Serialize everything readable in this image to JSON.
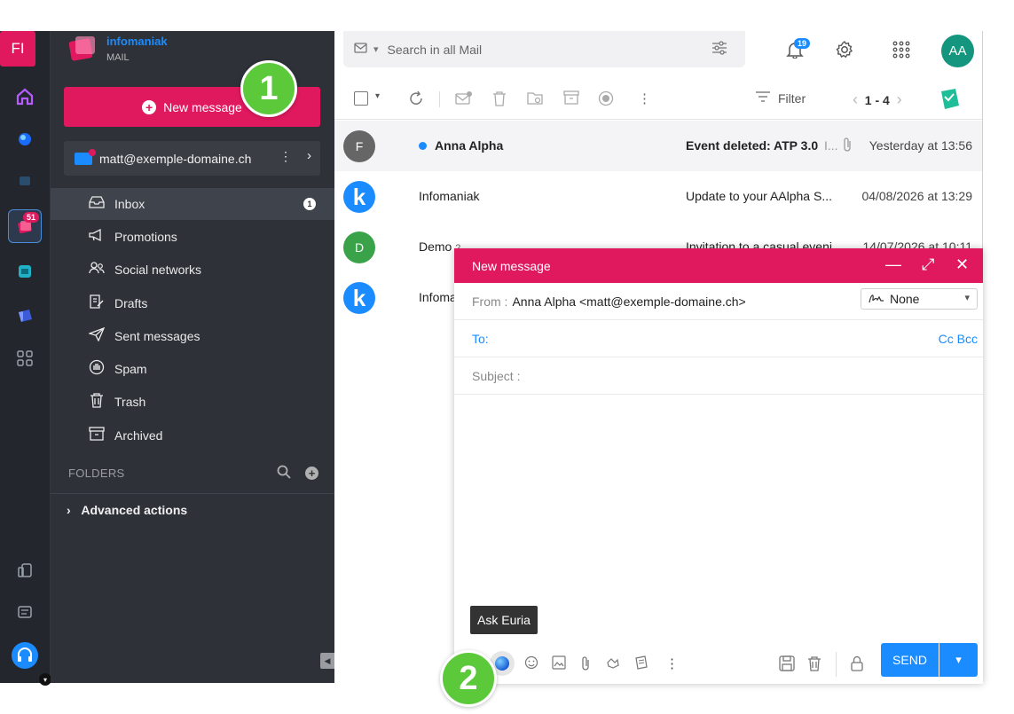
{
  "rail": {
    "avatar_initials": "FI",
    "badge_count": "51"
  },
  "sidebar": {
    "brand_name": "infomaniak",
    "brand_sub": "MAIL",
    "new_message_label": "New message",
    "account_email": "matt@exemple-domaine.ch",
    "items": [
      {
        "label": "Inbox",
        "icon": "inbox-icon",
        "count": "1"
      },
      {
        "label": "Promotions",
        "icon": "megaphone-icon"
      },
      {
        "label": "Social networks",
        "icon": "people-icon"
      },
      {
        "label": "Drafts",
        "icon": "draft-icon"
      },
      {
        "label": "Sent messages",
        "icon": "send-icon"
      },
      {
        "label": "Spam",
        "icon": "spam-icon"
      },
      {
        "label": "Trash",
        "icon": "trash-icon"
      },
      {
        "label": "Archived",
        "icon": "archive-icon"
      }
    ],
    "folders_header": "FOLDERS",
    "advanced_actions": "Advanced actions"
  },
  "header": {
    "search_placeholder": "Search in all Mail",
    "notifications_count": "19",
    "user_initials": "AA"
  },
  "toolbar": {
    "filter_label": "Filter",
    "pager": "1 - 4"
  },
  "messages": [
    {
      "initial": "F",
      "avatar_color": "#666666",
      "from": "Anna Alpha",
      "subject": "Event deleted: ATP 3.0",
      "date": "Yesterday at 13:56",
      "unread": true
    },
    {
      "initial": "k",
      "avatar_color": "#1a8cff",
      "from": "Infomaniak",
      "subject": "Update to your AAlpha S...",
      "date": "04/08/2026 at 13:29"
    },
    {
      "initial": "D",
      "avatar_color": "#3aa34a",
      "from": "Demo",
      "from_count": "2",
      "subject": "Invitation to a casual eveni",
      "date": "14/07/2026 at 10:11"
    },
    {
      "initial": "k",
      "avatar_color": "#1a8cff",
      "from": "Infoma"
    }
  ],
  "compose": {
    "title": "New message",
    "from_label": "From :",
    "from_value": "Anna Alpha  <matt@exemple-domaine.ch>",
    "signature": "None",
    "to_label": "To:",
    "cc_bcc": "Cc Bcc",
    "subject_label": "Subject :",
    "tooltip": "Ask Euria",
    "send_label": "SEND"
  },
  "callouts": [
    "1",
    "2"
  ],
  "colors": {
    "brand_pink": "#e0195f",
    "accent_blue": "#1a8cff",
    "callout_green": "#5cc93a",
    "sidebar_bg": "#2e3138",
    "rail_bg": "#23262d"
  }
}
